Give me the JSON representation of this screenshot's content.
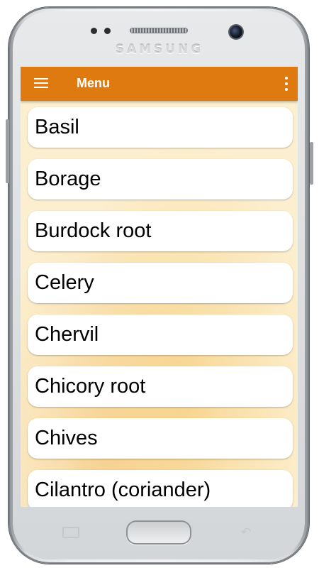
{
  "device": {
    "brand": "SAMSUNG"
  },
  "app_bar": {
    "title": "Menu",
    "nav_icon": "hamburger-menu-icon",
    "overflow_icon": "more-vert-icon",
    "color": "#de7a0f"
  },
  "list": {
    "items": [
      {
        "label": "Basil"
      },
      {
        "label": "Borage"
      },
      {
        "label": "Burdock root"
      },
      {
        "label": "Celery"
      },
      {
        "label": "Chervil"
      },
      {
        "label": "Chicory root"
      },
      {
        "label": "Chives"
      },
      {
        "label": "Cilantro (coriander)"
      }
    ]
  },
  "hardware_keys": {
    "recent_icon": "recent-apps-icon",
    "home_icon": "home-button",
    "back_icon": "back-arrow-icon"
  },
  "colors": {
    "screen_background": "#fcefcf",
    "card_background": "#ffffff"
  }
}
